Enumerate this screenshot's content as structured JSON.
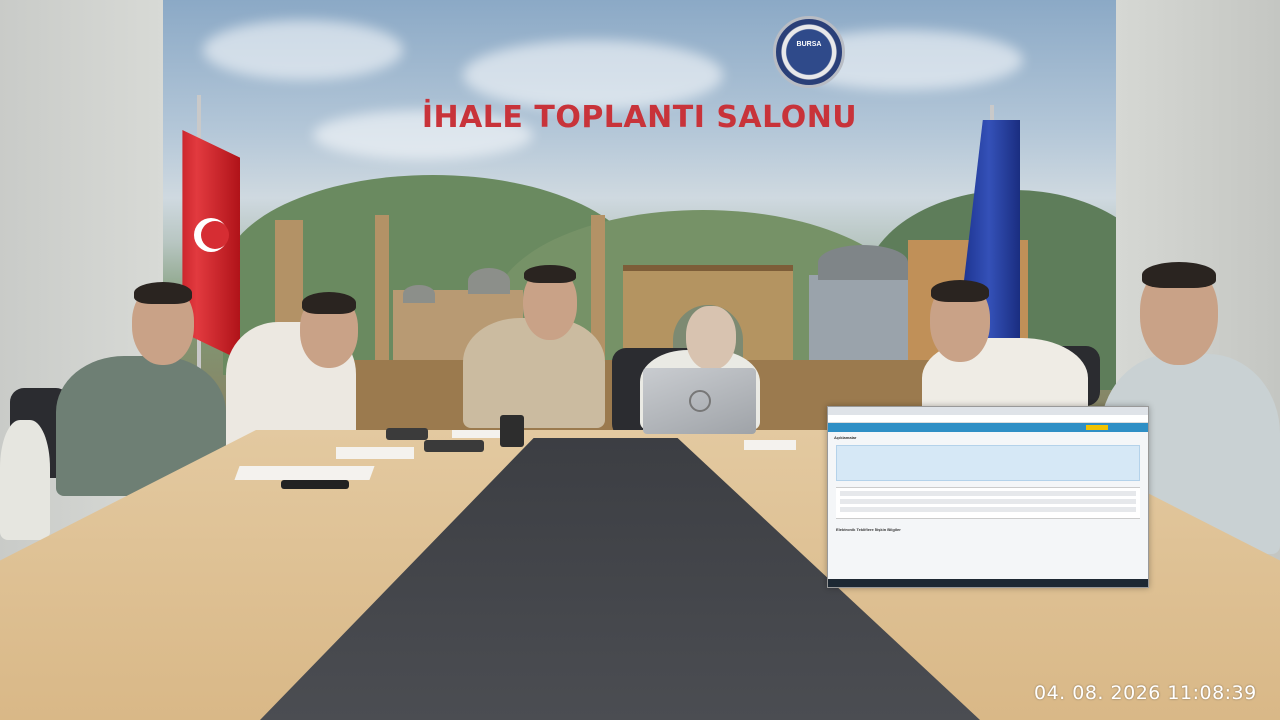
{
  "mural": {
    "title": "İHALE TOPLANTI SALONU",
    "logo_text": "BURSA"
  },
  "screen": {
    "heading": "Açıklamalar",
    "subheading": "Elektronik Tekliflere İlişkin Bilgiler"
  },
  "overlay": {
    "timestamp": "04. 08. 2026  11:08:39"
  },
  "colors": {
    "title_red": "#c8333a",
    "runner": "#45474c",
    "table_wood": "#dcbd8d",
    "screen_nav": "#2f8fc5"
  }
}
